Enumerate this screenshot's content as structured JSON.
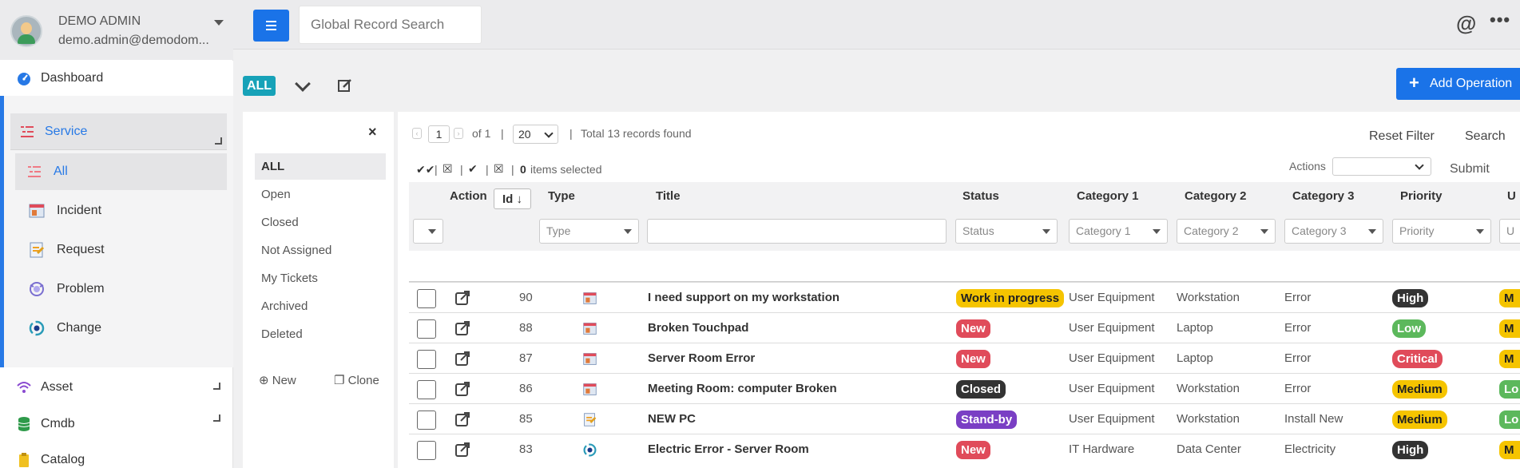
{
  "user": {
    "name": "DEMO ADMIN",
    "email": "demo.admin@demodom..."
  },
  "nav": {
    "dashboard": "Dashboard",
    "service": "Service",
    "all": "All",
    "incident": "Incident",
    "request": "Request",
    "problem": "Problem",
    "change": "Change",
    "asset": "Asset",
    "cmdb": "Cmdb",
    "catalog": "Catalog"
  },
  "topbar": {
    "search_placeholder": "Global Record Search",
    "at_icon": "@",
    "more_icon": "•••"
  },
  "toolbar": {
    "all_badge": "ALL",
    "add_operation": "Add Operation"
  },
  "filter_panel": {
    "close": "×",
    "items": [
      "ALL",
      "Open",
      "Closed",
      "Not Assigned",
      "My Tickets",
      "Archived",
      "Deleted"
    ],
    "new": "New",
    "clone": "Clone"
  },
  "pagination": {
    "page": "1",
    "of": "of 1",
    "sep": "|",
    "page_size": "20",
    "total": "Total 13 records found",
    "selected_count": "0",
    "selected_label": "items selected"
  },
  "grid_actions": {
    "reset_filter": "Reset Filter",
    "search": "Search",
    "actions_label": "Actions",
    "submit": "Submit"
  },
  "columns": {
    "action": "Action",
    "id": "Id",
    "type": "Type",
    "title": "Title",
    "status": "Status",
    "category1": "Category 1",
    "category2": "Category 2",
    "category3": "Category 3",
    "priority": "Priority",
    "urgency": "U"
  },
  "filters": {
    "type": "Type",
    "status": "Status",
    "category1": "Category 1",
    "category2": "Category 2",
    "category3": "Category 3",
    "priority": "Priority",
    "urgency": "U"
  },
  "colors": {
    "accent": "#1a73e8",
    "work_in_progress": "#f5c400",
    "new": "#e04b5a",
    "closed": "#333333",
    "standby": "#7a3fc4",
    "high": "#333333",
    "low": "#5cb85c",
    "critical": "#e04b5a",
    "medium": "#f5c400"
  },
  "rows": [
    {
      "id": "90",
      "type_icon": "incident-icon",
      "title": "I need support on my workstation",
      "status": "Work in progress",
      "status_color": "#f5c400",
      "status_text": "#222",
      "cat1": "User Equipment",
      "cat2": "Workstation",
      "cat3": "Error",
      "priority": "High",
      "prio_color": "#333333",
      "prio_text": "#fff",
      "urgency": "M",
      "urg_color": "#f5c400",
      "urg_text": "#222"
    },
    {
      "id": "88",
      "type_icon": "incident-icon",
      "title": "Broken Touchpad",
      "status": "New",
      "status_color": "#e04b5a",
      "status_text": "#fff",
      "cat1": "User Equipment",
      "cat2": "Laptop",
      "cat3": "Error",
      "priority": "Low",
      "prio_color": "#5cb85c",
      "prio_text": "#fff",
      "urgency": "M",
      "urg_color": "#f5c400",
      "urg_text": "#222"
    },
    {
      "id": "87",
      "type_icon": "incident-icon",
      "title": "Server Room Error",
      "status": "New",
      "status_color": "#e04b5a",
      "status_text": "#fff",
      "cat1": "User Equipment",
      "cat2": "Laptop",
      "cat3": "Error",
      "priority": "Critical",
      "prio_color": "#e04b5a",
      "prio_text": "#fff",
      "urgency": "M",
      "urg_color": "#f5c400",
      "urg_text": "#222"
    },
    {
      "id": "86",
      "type_icon": "incident-icon",
      "title": "Meeting Room: computer Broken",
      "status": "Closed",
      "status_color": "#333333",
      "status_text": "#fff",
      "cat1": "User Equipment",
      "cat2": "Workstation",
      "cat3": "Error",
      "priority": "Medium",
      "prio_color": "#f5c400",
      "prio_text": "#222",
      "urgency": "Lo",
      "urg_color": "#5cb85c",
      "urg_text": "#fff"
    },
    {
      "id": "85",
      "type_icon": "request-icon",
      "title": "NEW PC",
      "status": "Stand-by",
      "status_color": "#7a3fc4",
      "status_text": "#fff",
      "cat1": "User Equipment",
      "cat2": "Workstation",
      "cat3": "Install New",
      "priority": "Medium",
      "prio_color": "#f5c400",
      "prio_text": "#222",
      "urgency": "Lo",
      "urg_color": "#5cb85c",
      "urg_text": "#fff"
    },
    {
      "id": "83",
      "type_icon": "change-icon",
      "title": "Electric Error - Server Room",
      "status": "New",
      "status_color": "#e04b5a",
      "status_text": "#fff",
      "cat1": "IT Hardware",
      "cat2": "Data Center",
      "cat3": "Electricity",
      "priority": "High",
      "prio_color": "#333333",
      "prio_text": "#fff",
      "urgency": "M",
      "urg_color": "#f5c400",
      "urg_text": "#222"
    }
  ]
}
